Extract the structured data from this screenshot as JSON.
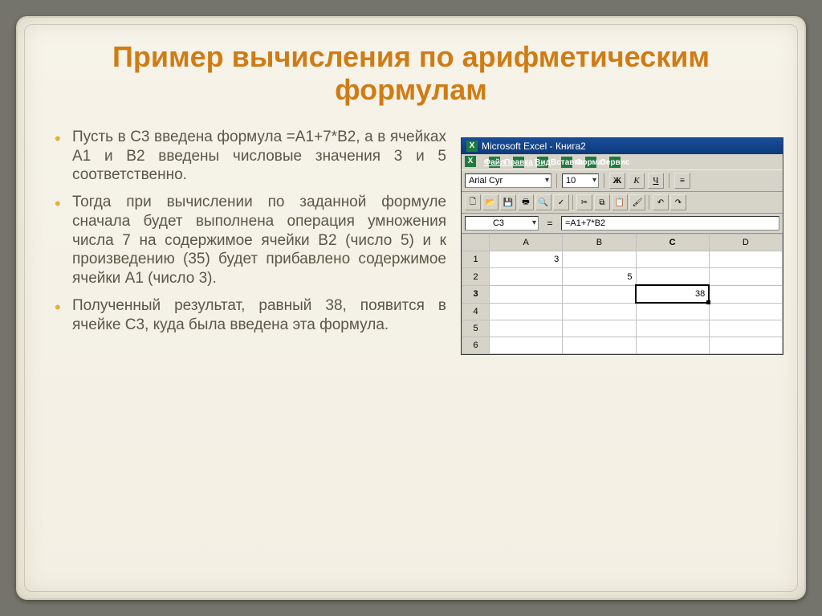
{
  "slide": {
    "title": "Пример вычисления по арифметическим формулам",
    "bullets": [
      "Пусть в С3 введена формула =А1+7*В2, а в ячейках А1 и В2 введены числовые значения 3 и 5 соответственно.",
      "Тогда при вычислении по заданной формуле сначала будет выполнена операция умножения числа 7 на содержимое ячейки В2 (число 5) и к произведению (35) будет прибавлено содержимое ячейки А1 (число 3).",
      "Полученный результат, равный 38, появится в ячейке С3, куда была введена эта формула."
    ]
  },
  "excel": {
    "title": "Microsoft Excel - Книга2",
    "menu": [
      "Файл",
      "Правка",
      "Вид",
      "Вставка",
      "Формат",
      "Сервис"
    ],
    "font_name": "Arial Cyr",
    "font_size": "10",
    "bold_label": "Ж",
    "italic_label": "К",
    "underline_label": "Ч",
    "active_cell": "C3",
    "formula": "=A1+7*B2",
    "columns": [
      "A",
      "B",
      "C",
      "D"
    ],
    "rows": [
      {
        "h": "1",
        "cells": [
          "3",
          "",
          "",
          ""
        ]
      },
      {
        "h": "2",
        "cells": [
          "",
          "5",
          "",
          ""
        ]
      },
      {
        "h": "3",
        "cells": [
          "",
          "",
          "38",
          ""
        ],
        "selected_col": 2
      },
      {
        "h": "4",
        "cells": [
          "",
          "",
          "",
          ""
        ]
      },
      {
        "h": "5",
        "cells": [
          "",
          "",
          "",
          ""
        ]
      },
      {
        "h": "6",
        "cells": [
          "",
          "",
          "",
          ""
        ]
      }
    ]
  }
}
